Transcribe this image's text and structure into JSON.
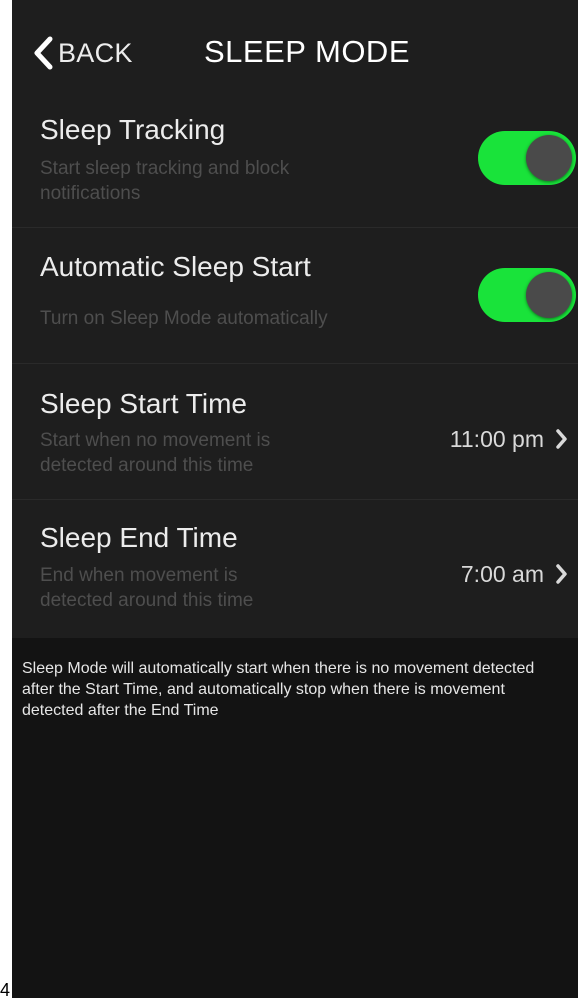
{
  "nav": {
    "back_label": "BACK",
    "title": "SLEEP MODE"
  },
  "settings": [
    {
      "title": "Sleep Tracking",
      "subtitle_lines": [
        "Start sleep tracking and block",
        "notifications"
      ],
      "toggle_on": true
    },
    {
      "title": "Automatic Sleep Start",
      "subtitle_lines": [
        "Turn on Sleep Mode automatically"
      ],
      "toggle_on": true
    },
    {
      "title": "Sleep Start Time",
      "subtitle_lines": [
        "Start when no movement is",
        "detected around this time"
      ],
      "value": "11:00 pm"
    },
    {
      "title": "Sleep End Time",
      "subtitle_lines": [
        "End when movement is",
        "detected around this time"
      ],
      "value": "7:00 am"
    }
  ],
  "footer_note": "Sleep Mode will automatically start when there is no movement detected after the Start Time, and automatically stop when there is movement detected after the End Time",
  "corner_label": "4",
  "icons": {
    "back": "chevron-left-icon",
    "row_disclosure": "chevron-right-icon"
  },
  "colors": {
    "toggle_on": "#19e33a",
    "background": "#131313",
    "row_background": "#1e1e1e"
  }
}
